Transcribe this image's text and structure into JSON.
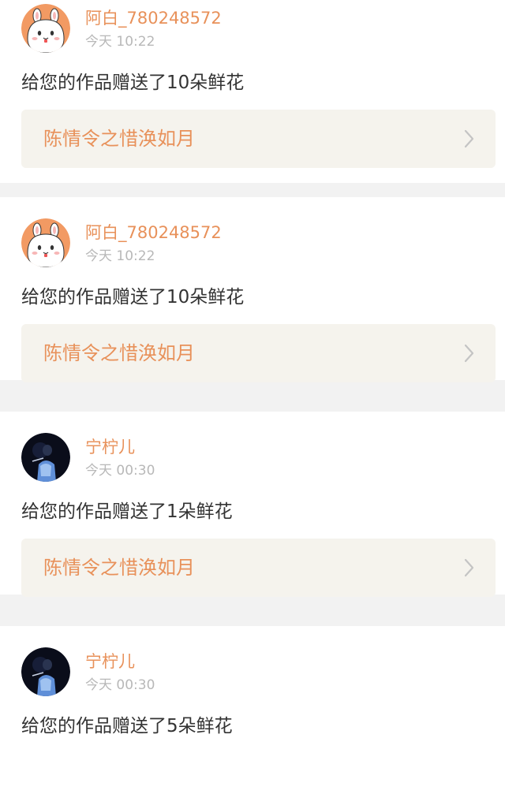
{
  "notifications": [
    {
      "user": {
        "name": "阿白_780248572",
        "avatar_icon": "bunny-avatar-icon"
      },
      "time": "今天 10:22",
      "message": "给您的作品赠送了10朵鲜花",
      "work_title": "陈情令之惜涣如月"
    },
    {
      "user": {
        "name": "阿白_780248572",
        "avatar_icon": "bunny-avatar-icon"
      },
      "time": "今天 10:22",
      "message": "给您的作品赠送了10朵鲜花",
      "work_title": "陈情令之惜涣如月"
    },
    {
      "user": {
        "name": "宁柠儿",
        "avatar_icon": "singer-avatar-icon"
      },
      "time": "今天 00:30",
      "message": "给您的作品赠送了1朵鲜花",
      "work_title": "陈情令之惜涣如月"
    },
    {
      "user": {
        "name": "宁柠儿",
        "avatar_icon": "singer-avatar-icon"
      },
      "time": "今天 00:30",
      "message": "给您的作品赠送了5朵鲜花",
      "work_title": ""
    }
  ],
  "colors": {
    "accent": "#e8915a",
    "text": "#333333",
    "muted": "#b8b8b8",
    "link_bg": "#f5f3ed",
    "separator": "#f2f2f2"
  }
}
